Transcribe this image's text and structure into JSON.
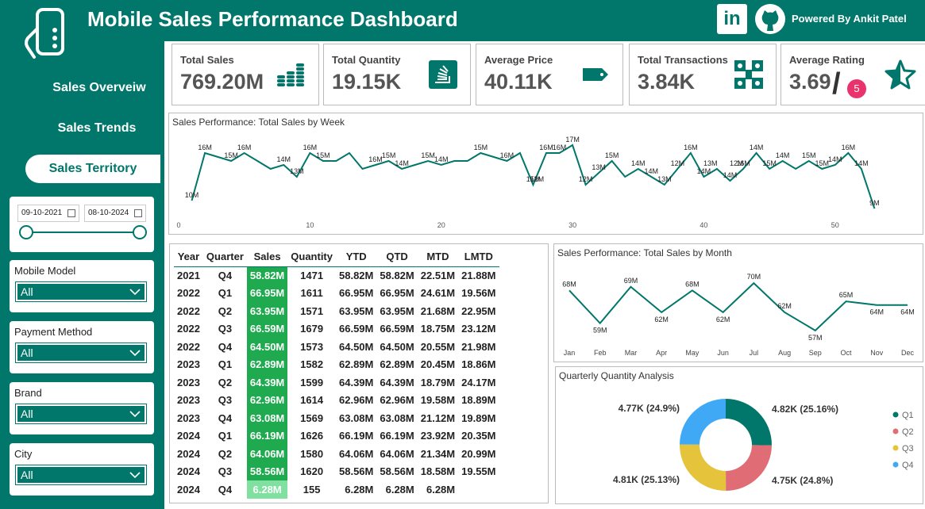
{
  "header": {
    "title": "Mobile Sales Performance Dashboard",
    "powered_by": "Powered By Ankit Patel",
    "icons": [
      "phone-icon",
      "linkedin-icon",
      "github-icon"
    ]
  },
  "sidebar": {
    "nav": [
      {
        "label": "Sales Overveiw",
        "active": false
      },
      {
        "label": "Sales Trends",
        "active": false
      },
      {
        "label": "Sales Territory",
        "active": true
      }
    ],
    "date_range": {
      "start": "09-10-2021",
      "end": "08-10-2024"
    },
    "slicers": [
      {
        "title": "Mobile Model",
        "value": "All"
      },
      {
        "title": "Payment Method",
        "value": "All"
      },
      {
        "title": "Brand",
        "value": "All"
      },
      {
        "title": "City",
        "value": "All"
      }
    ]
  },
  "kpis": [
    {
      "label": "Total Sales",
      "value": "769.20M",
      "icon": "coins-icon"
    },
    {
      "label": "Total Quantity",
      "value": "19.15K",
      "icon": "stack-icon"
    },
    {
      "label": "Average Price",
      "value": "40.11K",
      "icon": "price-tag-icon"
    },
    {
      "label": "Total Transactions",
      "value": "3.84K",
      "icon": "transactions-icon"
    },
    {
      "label": "Average Rating",
      "value": "3.69",
      "max": "5",
      "icon": "star-icon"
    }
  ],
  "colors": {
    "primary": "#00776a",
    "sales_cell": "#1faa4f",
    "sales_light": "#7fe0a0",
    "q1": "#00776a",
    "q2": "#e06c75",
    "q3": "#e5c33b",
    "q4": "#3fa9f5",
    "badge": "#e8336d"
  },
  "matrix": {
    "headers": [
      "Year",
      "Quarter",
      "Sales",
      "Quantity",
      "YTD",
      "QTD",
      "MTD",
      "LMTD"
    ],
    "rows": [
      [
        "2021",
        "Q4",
        "58.82M",
        "1471",
        "58.82M",
        "58.82M",
        "22.51M",
        "21.88M"
      ],
      [
        "2022",
        "Q1",
        "66.95M",
        "1611",
        "66.95M",
        "66.95M",
        "24.61M",
        "19.56M"
      ],
      [
        "2022",
        "Q2",
        "63.95M",
        "1571",
        "63.95M",
        "63.95M",
        "21.68M",
        "22.95M"
      ],
      [
        "2022",
        "Q3",
        "66.59M",
        "1679",
        "66.59M",
        "66.59M",
        "18.75M",
        "23.12M"
      ],
      [
        "2022",
        "Q4",
        "64.50M",
        "1573",
        "64.50M",
        "64.50M",
        "20.55M",
        "21.98M"
      ],
      [
        "2023",
        "Q1",
        "62.89M",
        "1582",
        "62.89M",
        "62.89M",
        "20.45M",
        "18.86M"
      ],
      [
        "2023",
        "Q2",
        "64.39M",
        "1599",
        "64.39M",
        "64.39M",
        "18.79M",
        "24.17M"
      ],
      [
        "2023",
        "Q3",
        "62.96M",
        "1614",
        "62.96M",
        "62.96M",
        "19.58M",
        "18.89M"
      ],
      [
        "2023",
        "Q4",
        "63.08M",
        "1569",
        "63.08M",
        "63.08M",
        "21.12M",
        "19.89M"
      ],
      [
        "2024",
        "Q1",
        "66.19M",
        "1626",
        "66.19M",
        "66.19M",
        "23.92M",
        "20.35M"
      ],
      [
        "2024",
        "Q2",
        "64.06M",
        "1580",
        "64.06M",
        "64.06M",
        "21.34M",
        "20.99M"
      ],
      [
        "2024",
        "Q3",
        "58.56M",
        "1620",
        "58.56M",
        "58.56M",
        "18.58M",
        "19.55M"
      ],
      [
        "2024",
        "Q4",
        "6.28M",
        "155",
        "6.28M",
        "6.28M",
        "6.28M",
        ""
      ]
    ]
  },
  "chart_data": [
    {
      "type": "line",
      "title": "Sales Performance: Total Sales by Week",
      "x": [
        1,
        2,
        3,
        4,
        5,
        6,
        7,
        8,
        9,
        10,
        11,
        12,
        13,
        14,
        15,
        16,
        17,
        18,
        19,
        20,
        21,
        22,
        23,
        24,
        25,
        26,
        27,
        28,
        29,
        30,
        31,
        32,
        33,
        34,
        35,
        36,
        37,
        38,
        39,
        40,
        41,
        42,
        43,
        44,
        45,
        46,
        47,
        48,
        49,
        50,
        51,
        52,
        53
      ],
      "values": [
        10,
        16,
        15.5,
        15,
        16,
        15,
        14,
        14.5,
        13,
        16,
        15,
        15,
        16,
        14,
        14.5,
        15,
        14,
        14.5,
        15,
        14.5,
        15,
        15,
        16,
        15.5,
        15,
        16,
        12,
        16,
        16,
        17,
        12,
        13.5,
        15,
        13,
        14,
        13,
        12,
        14,
        16,
        13,
        14,
        12.5,
        14,
        16,
        14,
        15,
        14,
        15,
        14,
        14.5,
        16,
        14,
        9
      ],
      "labels": [
        {
          "x": 1,
          "text": "10M"
        },
        {
          "x": 2,
          "text": "16M"
        },
        {
          "x": 5,
          "text": "16M"
        },
        {
          "x": 4,
          "text": "15M"
        },
        {
          "x": 8,
          "text": "14M"
        },
        {
          "x": 9,
          "text": "13M"
        },
        {
          "x": 10,
          "text": "16M"
        },
        {
          "x": 11,
          "text": "15M"
        },
        {
          "x": 15,
          "text": "16M"
        },
        {
          "x": 16,
          "text": "15M"
        },
        {
          "x": 17,
          "text": "14M"
        },
        {
          "x": 19,
          "text": "15M"
        },
        {
          "x": 20,
          "text": "14M"
        },
        {
          "x": 23,
          "text": "15M"
        },
        {
          "x": 25,
          "text": "16M"
        },
        {
          "x": 27,
          "text": "15M"
        },
        {
          "x": 28,
          "text": "16M"
        },
        {
          "x": 27.3,
          "text": "12M"
        },
        {
          "x": 29,
          "text": "16M"
        },
        {
          "x": 30,
          "text": "17M"
        },
        {
          "x": 31,
          "text": "12M"
        },
        {
          "x": 32,
          "text": "13M"
        },
        {
          "x": 33,
          "text": "15M"
        },
        {
          "x": 35,
          "text": "14M"
        },
        {
          "x": 36,
          "text": "14M"
        },
        {
          "x": 37,
          "text": "13M"
        },
        {
          "x": 38,
          "text": "12M"
        },
        {
          "x": 39,
          "text": "16M"
        },
        {
          "x": 40,
          "text": "14M"
        },
        {
          "x": 40.5,
          "text": "13M"
        },
        {
          "x": 42,
          "text": "14M"
        },
        {
          "x": 42.5,
          "text": "12M"
        },
        {
          "x": 43,
          "text": "16M"
        },
        {
          "x": 44,
          "text": "14M"
        },
        {
          "x": 45,
          "text": "15M"
        },
        {
          "x": 46,
          "text": "14M"
        },
        {
          "x": 48,
          "text": "15M"
        },
        {
          "x": 49,
          "text": "15M"
        },
        {
          "x": 50,
          "text": "14M"
        },
        {
          "x": 51,
          "text": "16M"
        },
        {
          "x": 52,
          "text": "14M"
        },
        {
          "x": 53,
          "text": "9M"
        }
      ],
      "xticks": [
        0,
        10,
        20,
        30,
        40,
        50
      ],
      "xlim": [
        0,
        56
      ],
      "ylim": [
        8,
        18
      ]
    },
    {
      "type": "line",
      "title": "Sales Performance: Total Sales by Month",
      "categories": [
        "Jan",
        "Feb",
        "Mar",
        "Apr",
        "May",
        "Jun",
        "Jul",
        "Aug",
        "Sep",
        "Oct",
        "Nov",
        "Dec"
      ],
      "values": [
        68,
        59,
        69,
        62,
        68,
        62,
        70,
        62,
        57,
        65,
        64,
        64
      ],
      "data_labels": [
        "68M",
        "59M",
        "69M",
        "62M",
        "68M",
        "62M",
        "70M",
        "62M",
        "57M",
        "65M",
        "64M",
        "64M"
      ],
      "ylim": [
        55,
        72
      ]
    },
    {
      "type": "pie",
      "title": "Quarterly Quantity Analysis",
      "donut": true,
      "categories": [
        "Q1",
        "Q2",
        "Q3",
        "Q4"
      ],
      "values": [
        25.16,
        24.8,
        25.13,
        24.9
      ],
      "data_labels": [
        "4.82K (25.16%)",
        "4.75K (24.8%)",
        "4.81K (25.13%)",
        "4.77K (24.9%)"
      ],
      "legend": "right"
    }
  ]
}
